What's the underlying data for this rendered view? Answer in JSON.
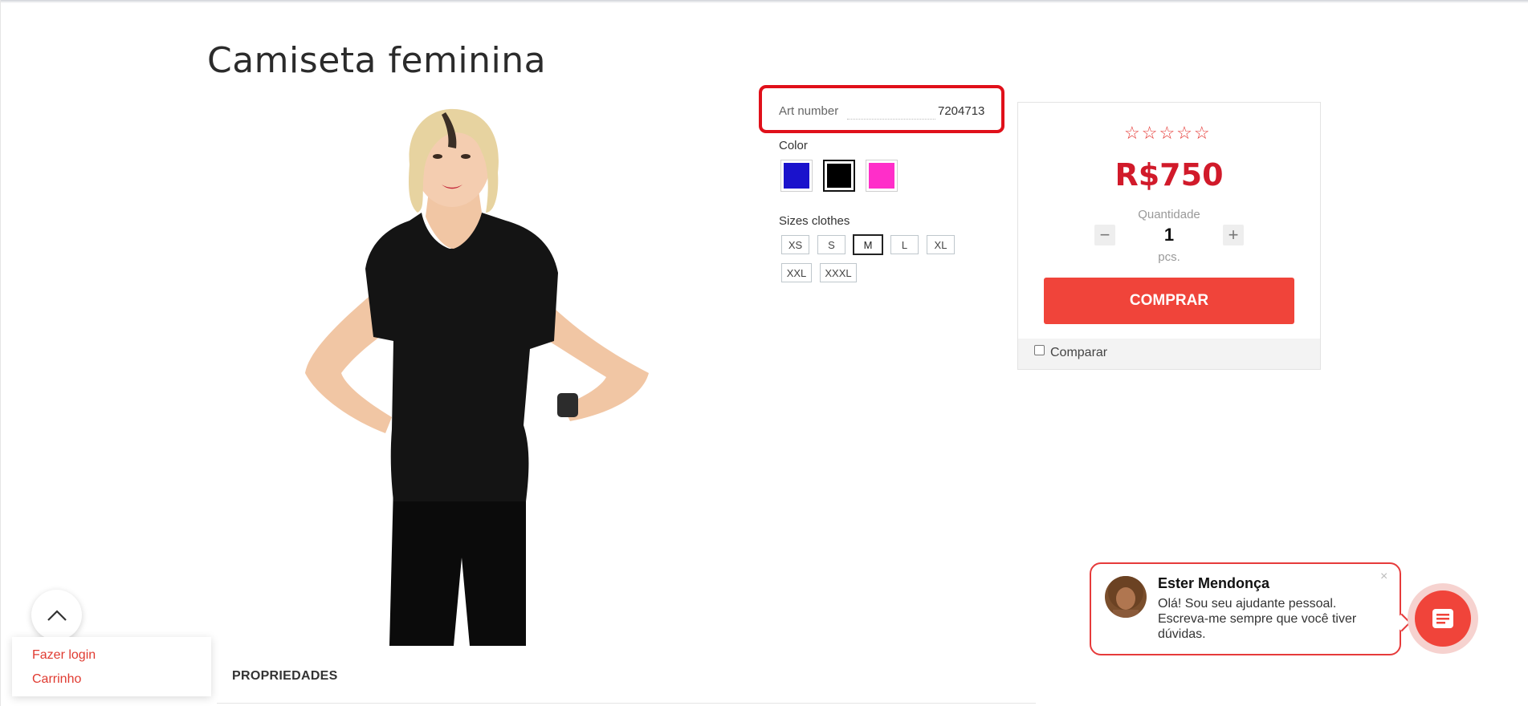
{
  "product": {
    "title": "Camiseta feminina",
    "art_number_label": "Art number",
    "art_number_value": "7204713",
    "color_label": "Color",
    "colors": [
      {
        "name": "blue",
        "hex": "#1a12cc",
        "selected": false
      },
      {
        "name": "black",
        "hex": "#000000",
        "selected": true
      },
      {
        "name": "pink",
        "hex": "#ff2ec9",
        "selected": false
      }
    ],
    "sizes_label": "Sizes clothes",
    "sizes": [
      "XS",
      "S",
      "M",
      "L",
      "XL",
      "XXL",
      "XXXL"
    ],
    "selected_size": "M"
  },
  "buy_panel": {
    "rating_stars": "☆☆☆☆☆",
    "rating_value": 0,
    "rating_max": 5,
    "price": "R$750",
    "quantity_label": "Quantidade",
    "quantity_value": "1",
    "quantity_unit": "pcs.",
    "decrement": "−",
    "increment": "+",
    "buy_label": "COMPRAR",
    "compare_label": "Comparar"
  },
  "account_menu": {
    "login": "Fazer login",
    "cart": "Carrinho"
  },
  "sections": {
    "properties": "PROPRIEDADES"
  },
  "chat": {
    "agent_name": "Ester Mendonça",
    "message": "Olá! Sou seu ajudante pessoal. Escreva-me sempre que você tiver dúvidas.",
    "close": "×"
  },
  "colors": {
    "accent": "#f0443a",
    "price": "#d11a2a",
    "highlight": "#e0101a"
  },
  "icons": {
    "scroll_top": "chevron-up-icon",
    "chat_launcher": "chat-icon",
    "rating": "star-outline-icon"
  }
}
